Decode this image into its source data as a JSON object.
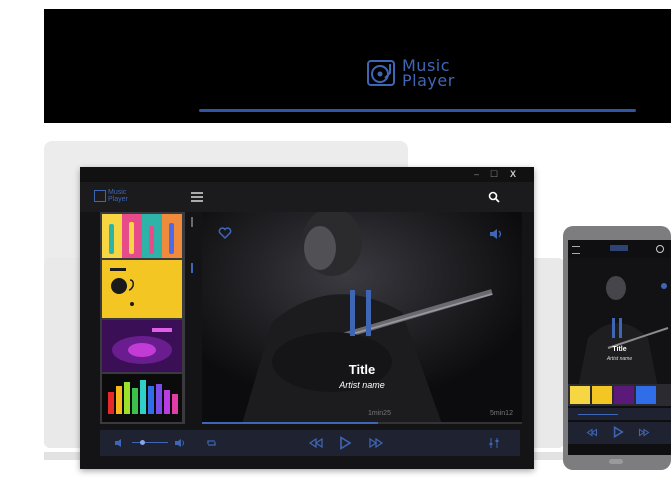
{
  "banner": {
    "logo_line1": "Music",
    "logo_line2": "Player",
    "icon": "turntable-icon"
  },
  "app": {
    "logo_line1": "Music",
    "logo_line2": "Player",
    "window_controls": {
      "minimize": "–",
      "maximize": "☐",
      "close": "X"
    },
    "icons": {
      "menu": "hamburger-icon",
      "search": "search-icon",
      "favorite": "heart-icon",
      "volume": "volume-icon"
    },
    "sidebar": {
      "thumbnails": [
        {
          "name": "guitars-colorful",
          "colors": [
            "#f6d743",
            "#2eb3a8",
            "#e84b8a",
            "#4c6be8"
          ]
        },
        {
          "name": "yellow-record",
          "colors": [
            "#f3c623",
            "#1a1a1a"
          ]
        },
        {
          "name": "purple-turntable",
          "colors": [
            "#5b1a7a",
            "#c23bd6"
          ]
        },
        {
          "name": "rainbow-equalizer",
          "colors": [
            "#e62a2a",
            "#f7b81c",
            "#3ac24a",
            "#2f6ee8",
            "#b93de0"
          ]
        }
      ]
    },
    "now_playing": {
      "title": "Title",
      "artist": "Artist name",
      "elapsed": "1min25",
      "total": "5min12",
      "progress": 0.55
    },
    "controls": {
      "shuffle": "shuffle-icon",
      "volume_down": "volume-down-icon",
      "volume_up": "volume-up-icon",
      "repeat": "repeat-icon",
      "prev": "previous-icon",
      "play": "play-icon",
      "next": "next-icon",
      "equalizer": "equalizer-icon",
      "volume_level": 0.3
    }
  },
  "phone": {
    "title": "Title",
    "artist": "Artist name"
  },
  "colors": {
    "accent": "#3f66b5",
    "bg": "#141416",
    "panel": "#1f2230"
  }
}
